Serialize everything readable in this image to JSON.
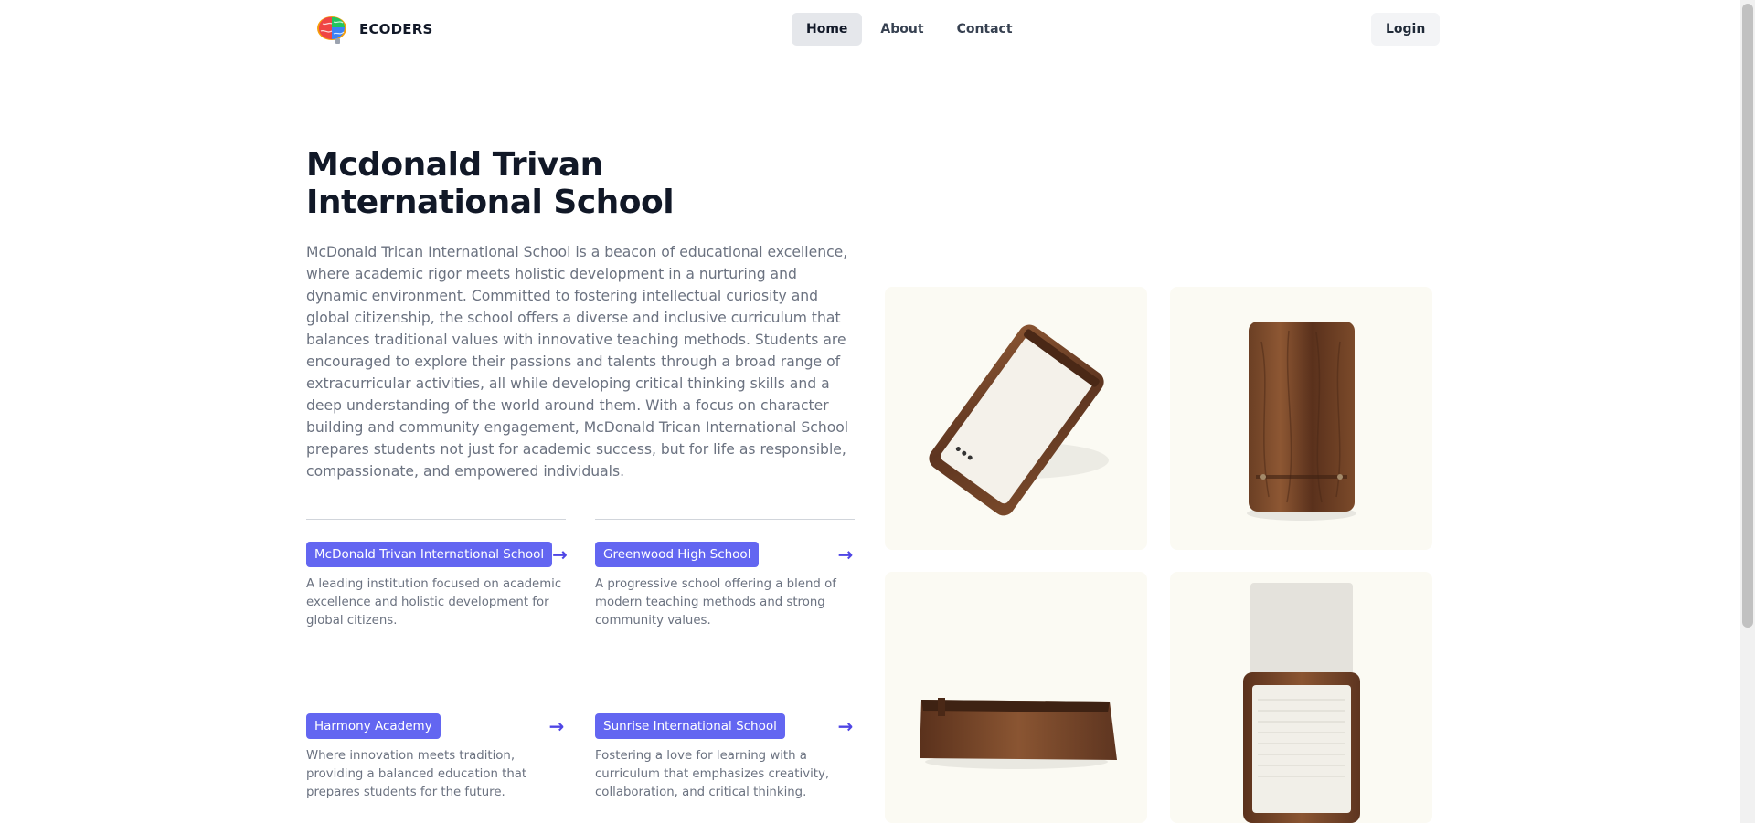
{
  "brand": {
    "name": "ECODERS",
    "logo_icon": "brain-logo-icon"
  },
  "nav": {
    "items": [
      "Home",
      "About",
      "Contact"
    ],
    "active": "Home"
  },
  "header": {
    "login_label": "Login"
  },
  "hero": {
    "title": "Mcdonald Trivan International School",
    "description": "McDonald Trican International School is a beacon of educational excellence, where academic rigor meets holistic development in a nurturing and dynamic environment. Committed to fostering intellectual curiosity and global citizenship, the school offers a diverse and inclusive curriculum that balances traditional values with innovative teaching methods. Students are encouraged to explore their passions and talents through a broad range of extracurricular activities, all while developing critical thinking skills and a deep understanding of the world around them. With a focus on character building and community engagement, McDonald Trican International School prepares students not just for academic success, but for life as responsible, compassionate, and empowered individuals."
  },
  "schools": [
    {
      "name": "McDonald Trivan International School",
      "description": "A leading institution focused on academic excellence and holistic development for global citizens.",
      "arrow": "→"
    },
    {
      "name": "Greenwood High School",
      "description": "A progressive school offering a blend of modern teaching methods and strong community values.",
      "arrow": "→"
    },
    {
      "name": "Harmony Academy",
      "description": "Where innovation meets tradition, providing a balanced education that prepares students for the future.",
      "arrow": "→"
    },
    {
      "name": "Sunrise International School",
      "description": "Fostering a love for learning with a curriculum that emphasizes creativity, collaboration, and critical thinking.",
      "arrow": "→"
    }
  ],
  "colors": {
    "accent": "#6366f1",
    "arrow": "#4f46e5",
    "tile_bg": "#fbfaf3",
    "wood": "#6b3f24"
  },
  "gallery": {
    "tiles": [
      "wooden-card-tray-angled",
      "wooden-card-tray-top",
      "wooden-card-tray-side",
      "wooden-card-tray-open"
    ]
  }
}
